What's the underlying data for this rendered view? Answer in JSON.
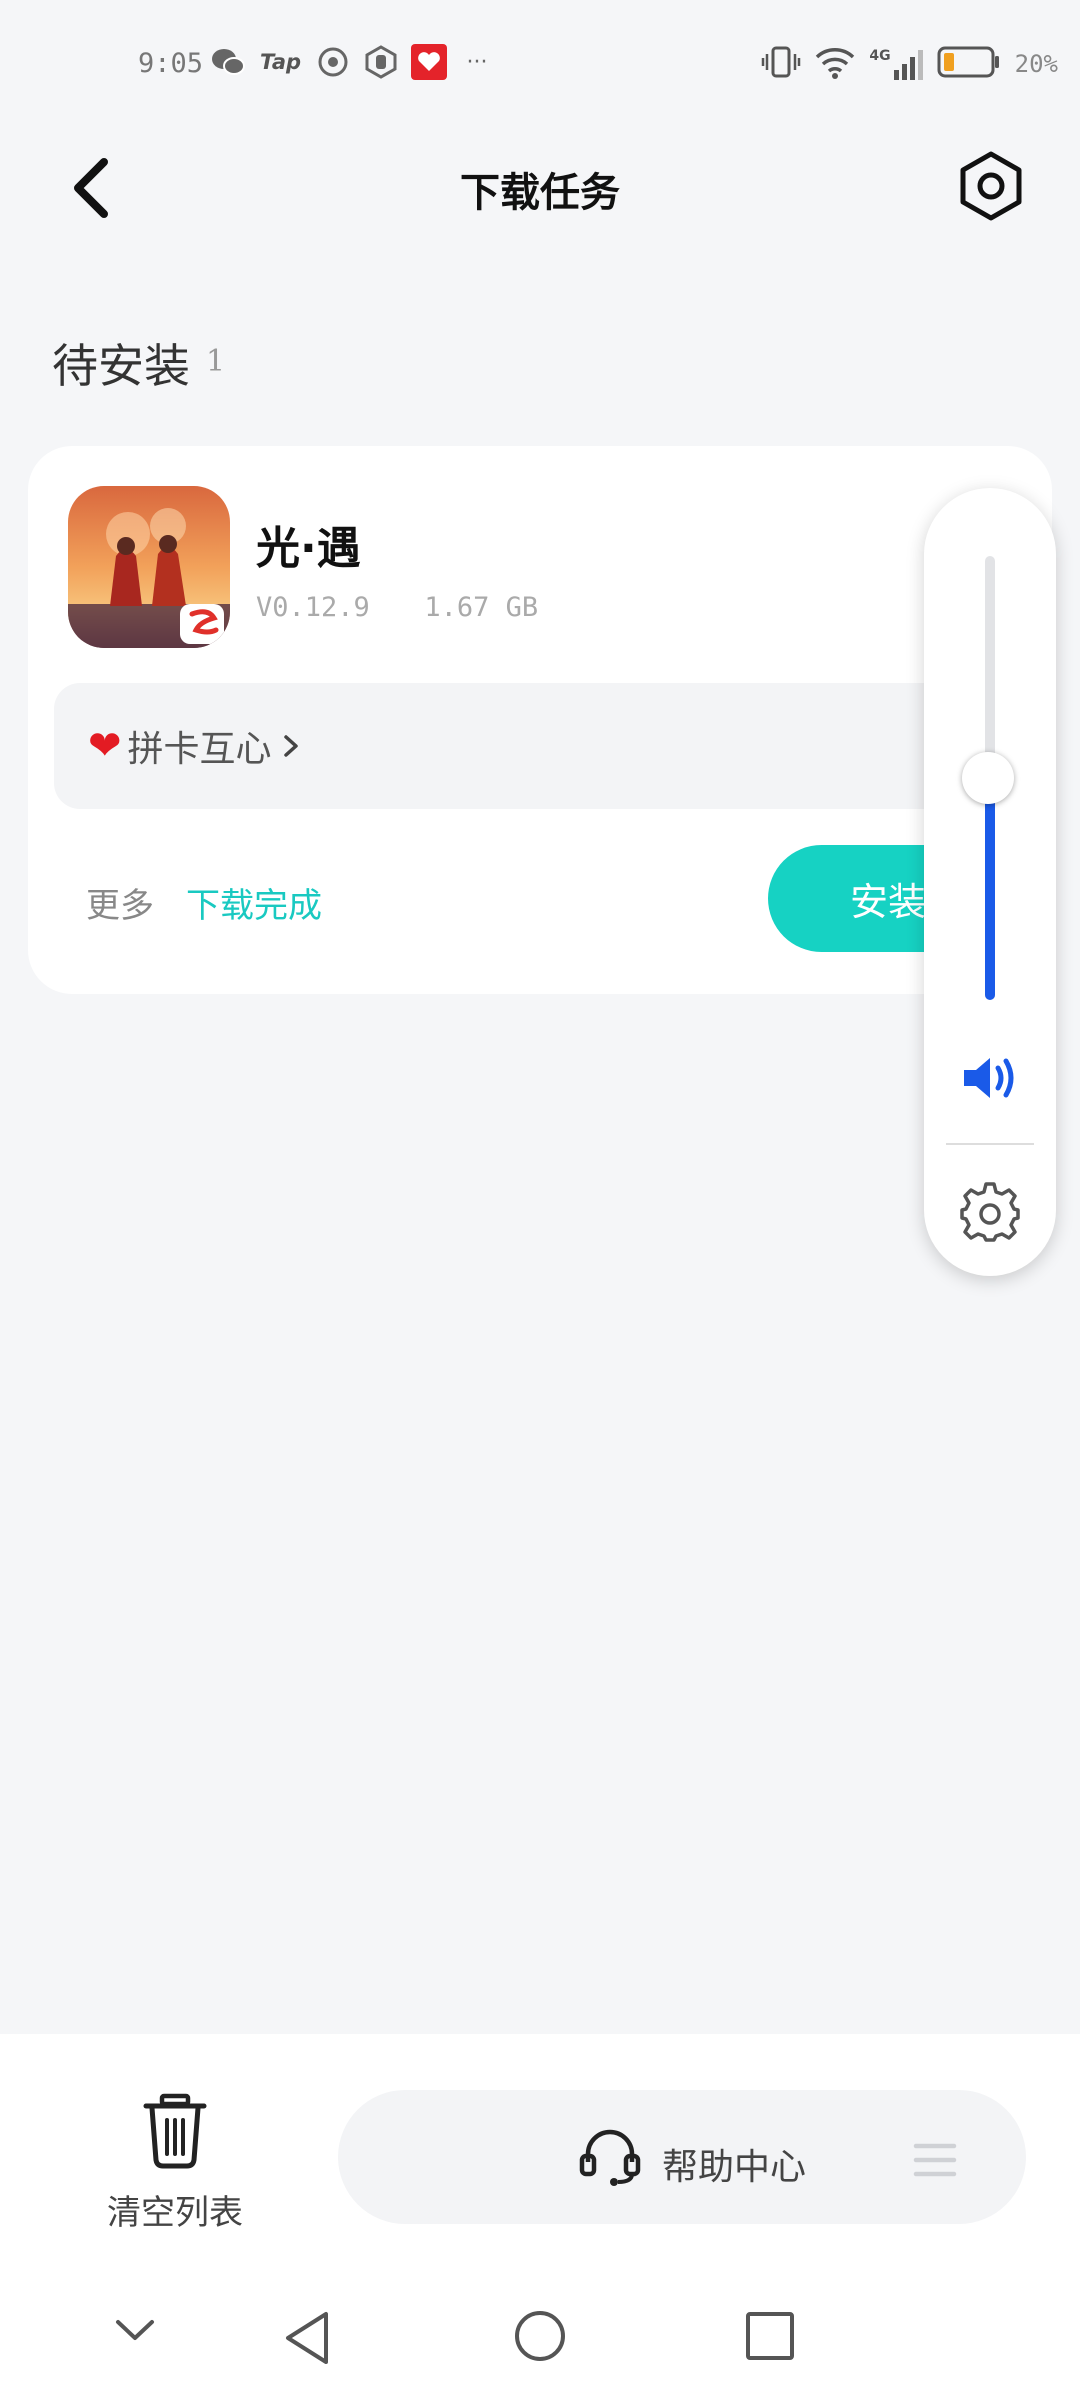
{
  "status_bar": {
    "time": "9:05",
    "left_icons": [
      "wechat-icon",
      "tap-icon",
      "app-icon",
      "app-icon",
      "app-badge-icon",
      "more-icon"
    ],
    "tap_text": "Tap",
    "more_text": "···",
    "network": "4G",
    "battery": "20%",
    "battery_color": "#f0a020"
  },
  "header": {
    "title": "下载任务"
  },
  "section": {
    "title": "待安装",
    "count": "1"
  },
  "task": {
    "app_name": "光·遇",
    "version": "V0.12.9",
    "size": "1.67 GB",
    "promo": "拼卡互心",
    "more_label": "更多",
    "status_label": "下载完成",
    "install_label": "安装"
  },
  "volume": {
    "level": 0.5,
    "accent": "#1a5ae8"
  },
  "bottom": {
    "clear_label": "清空列表",
    "help_label": "帮助中心"
  },
  "colors": {
    "accent_teal": "#16d2c3",
    "status_teal": "#19c9c1"
  }
}
